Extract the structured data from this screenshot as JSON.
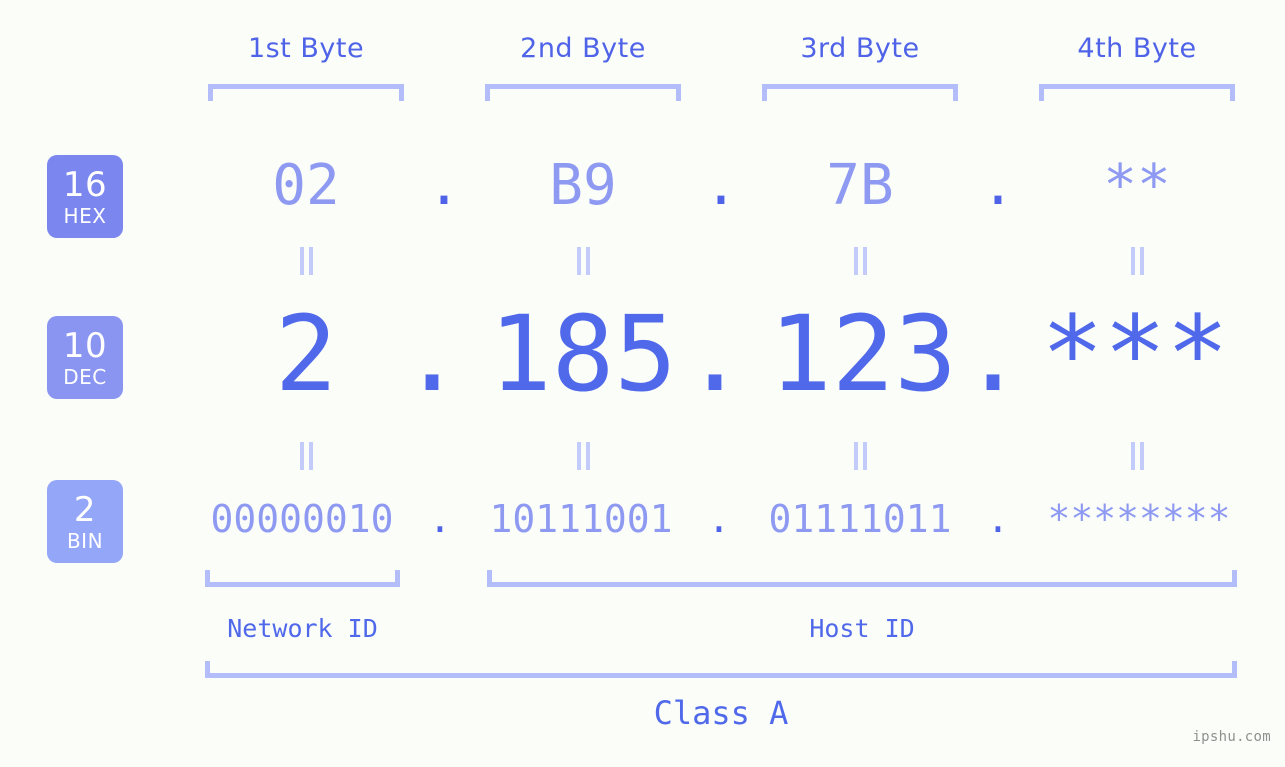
{
  "meta": {
    "background_color": "#fbfdf9",
    "accent_color": "#5069ea",
    "light_accent_color": "#8e9af2",
    "bracket_color": "#b3bdfa"
  },
  "byte_headers": [
    {
      "label": "1st Byte"
    },
    {
      "label": "2nd Byte"
    },
    {
      "label": "3rd Byte"
    },
    {
      "label": "4th Byte"
    }
  ],
  "bases": [
    {
      "number": "16",
      "name": "HEX",
      "color": "#7b87ee"
    },
    {
      "number": "10",
      "name": "DEC",
      "color": "#8a95f2"
    },
    {
      "number": "2",
      "name": "BIN",
      "color": "#93a6f8"
    }
  ],
  "rows": {
    "hex": {
      "values": [
        "02",
        "B9",
        "7B",
        "**"
      ],
      "separators": [
        ".",
        ".",
        "."
      ]
    },
    "dec": {
      "values": [
        "2",
        "185",
        "123",
        "***"
      ],
      "separators": [
        ".",
        ".",
        "."
      ]
    },
    "bin": {
      "values": [
        "00000010",
        "10111001",
        "01111011",
        "********"
      ],
      "separators": [
        ".",
        ".",
        "."
      ]
    }
  },
  "equality_marks": {
    "symbol": "=",
    "count_per_band": 4
  },
  "segments": [
    {
      "label": "Network ID"
    },
    {
      "label": "Host ID"
    }
  ],
  "class": {
    "label": "Class A"
  },
  "watermark": {
    "text": "ipshu.com"
  }
}
